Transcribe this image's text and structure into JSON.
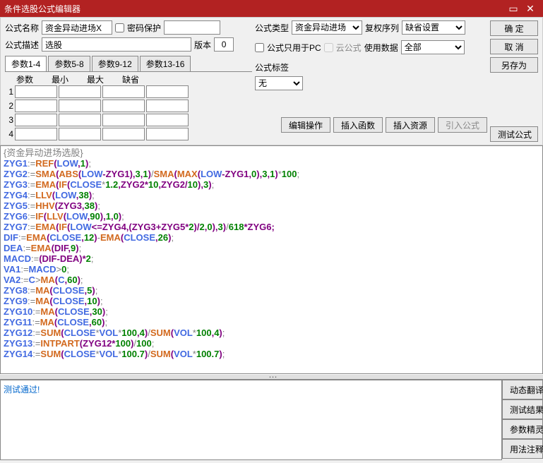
{
  "title": "条件选股公式编辑器",
  "labels": {
    "name": "公式名称",
    "pwprotect": "密码保护",
    "type": "公式类型",
    "rightseq": "复权序列",
    "desc": "公式描述",
    "version": "版本",
    "pconly": "公式只用于PC",
    "cloud": "云公式",
    "usedata": "使用数据",
    "tag": "公式标签"
  },
  "fields": {
    "name": "资金异动进场X",
    "desc": "选股",
    "version": "0",
    "type": "资金异动进场",
    "rightseq": "缺省设置",
    "usedata": "全部",
    "tag": "无"
  },
  "buttons": {
    "ok": "确 定",
    "cancel": "取 消",
    "saveas": "另存为",
    "editop": "编辑操作",
    "insfn": "插入函数",
    "insres": "插入资源",
    "imp": "引入公式",
    "test": "测试公式",
    "dyntr": "动态翻译",
    "testres": "测试结果",
    "paramwiz": "参数精灵",
    "usage": "用法注释"
  },
  "tabs": [
    "参数1-4",
    "参数5-8",
    "参数9-12",
    "参数13-16"
  ],
  "paramheaders": [
    "参数",
    "最小",
    "最大",
    "缺省"
  ],
  "codehead": "{资金异动进场选股}",
  "message": "测试通过!",
  "code": [
    [
      [
        "ZYG1",
        "kw"
      ],
      [
        ":=",
        "op"
      ],
      [
        "REF",
        "fn"
      ],
      [
        "(",
        "pn"
      ],
      [
        "LOW",
        "kw"
      ],
      [
        ",",
        "pn"
      ],
      [
        "1",
        "nm"
      ],
      [
        ")",
        "pn"
      ],
      [
        ";",
        "op"
      ]
    ],
    [
      [
        "ZYG2",
        "kw"
      ],
      [
        ":=",
        "op"
      ],
      [
        "SMA",
        "fn"
      ],
      [
        "(",
        "pn"
      ],
      [
        "ABS",
        "fn"
      ],
      [
        "(",
        "pn"
      ],
      [
        "LOW",
        "kw"
      ],
      [
        "-ZYG1)",
        "pn"
      ],
      [
        ",",
        "pn"
      ],
      [
        "3",
        "nm"
      ],
      [
        ",",
        "pn"
      ],
      [
        "1",
        "nm"
      ],
      [
        ")",
        "pn"
      ],
      [
        "/",
        "op"
      ],
      [
        "SMA",
        "fn"
      ],
      [
        "(",
        "pn"
      ],
      [
        "MAX",
        "fn"
      ],
      [
        "(",
        "pn"
      ],
      [
        "LOW",
        "kw"
      ],
      [
        "-ZYG1",
        "pn"
      ],
      [
        ",",
        "pn"
      ],
      [
        "0",
        "nm"
      ],
      [
        ")",
        "pn"
      ],
      [
        ",",
        "pn"
      ],
      [
        "3",
        "nm"
      ],
      [
        ",",
        "pn"
      ],
      [
        "1",
        "nm"
      ],
      [
        ")",
        "pn"
      ],
      [
        "*",
        "op"
      ],
      [
        "100",
        "nm"
      ],
      [
        ";",
        "op"
      ]
    ],
    [
      [
        "ZYG3",
        "kw"
      ],
      [
        ":=",
        "op"
      ],
      [
        "EMA",
        "fn"
      ],
      [
        "(",
        "pn"
      ],
      [
        "IF",
        "fn"
      ],
      [
        "(",
        "pn"
      ],
      [
        "CLOSE",
        "kw"
      ],
      [
        "*",
        "op"
      ],
      [
        "1.2",
        "nm"
      ],
      [
        ",ZYG2*",
        "pn"
      ],
      [
        "10",
        "nm"
      ],
      [
        ",ZYG2/",
        "pn"
      ],
      [
        "10",
        "nm"
      ],
      [
        ")",
        "pn"
      ],
      [
        ",",
        "pn"
      ],
      [
        "3",
        "nm"
      ],
      [
        ")",
        "pn"
      ],
      [
        ";",
        "op"
      ]
    ],
    [
      [
        "ZYG4",
        "kw"
      ],
      [
        ":=",
        "op"
      ],
      [
        "LLV",
        "fn"
      ],
      [
        "(",
        "pn"
      ],
      [
        "LOW",
        "kw"
      ],
      [
        ",",
        "pn"
      ],
      [
        "38",
        "nm"
      ],
      [
        ")",
        "pn"
      ],
      [
        ";",
        "op"
      ]
    ],
    [
      [
        "ZYG5",
        "kw"
      ],
      [
        ":=",
        "op"
      ],
      [
        "HHV",
        "fn"
      ],
      [
        "(ZYG3,",
        "pn"
      ],
      [
        "38",
        "nm"
      ],
      [
        ")",
        "pn"
      ],
      [
        ";",
        "op"
      ]
    ],
    [
      [
        "ZYG6",
        "kw"
      ],
      [
        ":=",
        "op"
      ],
      [
        "IF",
        "fn"
      ],
      [
        "(",
        "pn"
      ],
      [
        "LLV",
        "fn"
      ],
      [
        "(",
        "pn"
      ],
      [
        "LOW",
        "kw"
      ],
      [
        ",",
        "pn"
      ],
      [
        "90",
        "nm"
      ],
      [
        ")",
        "pn"
      ],
      [
        ",",
        "pn"
      ],
      [
        "1",
        "nm"
      ],
      [
        ",",
        "pn"
      ],
      [
        "0",
        "nm"
      ],
      [
        ")",
        "pn"
      ],
      [
        ";",
        "op"
      ]
    ],
    [
      [
        "ZYG7",
        "kw"
      ],
      [
        ":=",
        "op"
      ],
      [
        "EMA",
        "fn"
      ],
      [
        "(",
        "pn"
      ],
      [
        "IF",
        "fn"
      ],
      [
        "(",
        "pn"
      ],
      [
        "LOW",
        "kw"
      ],
      [
        "<=ZYG4,(ZYG3+ZYG5*",
        "pn"
      ],
      [
        "2",
        "nm"
      ],
      [
        ")/",
        "pn"
      ],
      [
        "2",
        "nm"
      ],
      [
        ",",
        "pn"
      ],
      [
        "0",
        "nm"
      ],
      [
        ")",
        "pn"
      ],
      [
        ",",
        "pn"
      ],
      [
        "3",
        "nm"
      ],
      [
        ")",
        "pn"
      ],
      [
        "/",
        "op"
      ],
      [
        "618",
        "nm"
      ],
      [
        "*ZYG6;",
        "pn"
      ]
    ],
    [
      [
        "DIF",
        "kw"
      ],
      [
        ":=",
        "op"
      ],
      [
        "EMA",
        "fn"
      ],
      [
        "(",
        "pn"
      ],
      [
        "CLOSE",
        "kw"
      ],
      [
        ",",
        "pn"
      ],
      [
        "12",
        "nm"
      ],
      [
        ")",
        "pn"
      ],
      [
        "-",
        "op"
      ],
      [
        "EMA",
        "fn"
      ],
      [
        "(",
        "pn"
      ],
      [
        "CLOSE",
        "kw"
      ],
      [
        ",",
        "pn"
      ],
      [
        "26",
        "nm"
      ],
      [
        ")",
        "pn"
      ],
      [
        ";",
        "op"
      ]
    ],
    [
      [
        "DEA",
        "kw"
      ],
      [
        ":=",
        "op"
      ],
      [
        "EMA",
        "fn"
      ],
      [
        "(DIF,",
        "pn"
      ],
      [
        "9",
        "nm"
      ],
      [
        ")",
        "pn"
      ],
      [
        ";",
        "op"
      ]
    ],
    [
      [
        "MACD",
        "kw"
      ],
      [
        ":=",
        "op"
      ],
      [
        "(DIF-DEA)*",
        "pn"
      ],
      [
        "2",
        "nm"
      ],
      [
        ";",
        "op"
      ]
    ],
    [
      [
        "VA1",
        "kw"
      ],
      [
        ":=",
        "op"
      ],
      [
        "MACD",
        "kw"
      ],
      [
        ">",
        "op"
      ],
      [
        "0",
        "nm"
      ],
      [
        ";",
        "op"
      ]
    ],
    [
      [
        "VA2",
        "kw"
      ],
      [
        ":=",
        "op"
      ],
      [
        "C",
        "kw"
      ],
      [
        ">",
        "op"
      ],
      [
        "MA",
        "fn"
      ],
      [
        "(",
        "pn"
      ],
      [
        "C",
        "kw"
      ],
      [
        ",",
        "pn"
      ],
      [
        "60",
        "nm"
      ],
      [
        ")",
        "pn"
      ],
      [
        ";",
        "op"
      ]
    ],
    [
      [
        "ZYG8",
        "kw"
      ],
      [
        ":=",
        "op"
      ],
      [
        "MA",
        "fn"
      ],
      [
        "(",
        "pn"
      ],
      [
        "CLOSE",
        "kw"
      ],
      [
        ",",
        "pn"
      ],
      [
        "5",
        "nm"
      ],
      [
        ")",
        "pn"
      ],
      [
        ";",
        "op"
      ]
    ],
    [
      [
        "ZYG9",
        "kw"
      ],
      [
        ":=",
        "op"
      ],
      [
        "MA",
        "fn"
      ],
      [
        "(",
        "pn"
      ],
      [
        "CLOSE",
        "kw"
      ],
      [
        ",",
        "pn"
      ],
      [
        "10",
        "nm"
      ],
      [
        ")",
        "pn"
      ],
      [
        ";",
        "op"
      ]
    ],
    [
      [
        "ZYG10",
        "kw"
      ],
      [
        ":=",
        "op"
      ],
      [
        "MA",
        "fn"
      ],
      [
        "(",
        "pn"
      ],
      [
        "CLOSE",
        "kw"
      ],
      [
        ",",
        "pn"
      ],
      [
        "30",
        "nm"
      ],
      [
        ")",
        "pn"
      ],
      [
        ";",
        "op"
      ]
    ],
    [
      [
        "ZYG11",
        "kw"
      ],
      [
        ":=",
        "op"
      ],
      [
        "MA",
        "fn"
      ],
      [
        "(",
        "pn"
      ],
      [
        "CLOSE",
        "kw"
      ],
      [
        ",",
        "pn"
      ],
      [
        "60",
        "nm"
      ],
      [
        ")",
        "pn"
      ],
      [
        ";",
        "op"
      ]
    ],
    [
      [
        "ZYG12",
        "kw"
      ],
      [
        ":=",
        "op"
      ],
      [
        "SUM",
        "fn"
      ],
      [
        "(",
        "pn"
      ],
      [
        "CLOSE",
        "kw"
      ],
      [
        "*",
        "op"
      ],
      [
        "VOL",
        "kw"
      ],
      [
        "*",
        "op"
      ],
      [
        "100",
        "nm"
      ],
      [
        ",",
        "pn"
      ],
      [
        "4",
        "nm"
      ],
      [
        ")",
        "pn"
      ],
      [
        "/",
        "op"
      ],
      [
        "SUM",
        "fn"
      ],
      [
        "(",
        "pn"
      ],
      [
        "VOL",
        "kw"
      ],
      [
        "*",
        "op"
      ],
      [
        "100",
        "nm"
      ],
      [
        ",",
        "pn"
      ],
      [
        "4",
        "nm"
      ],
      [
        ")",
        "pn"
      ],
      [
        ";",
        "op"
      ]
    ],
    [
      [
        "ZYG13",
        "kw"
      ],
      [
        ":=",
        "op"
      ],
      [
        "INTPART",
        "fn"
      ],
      [
        "(ZYG12*",
        "pn"
      ],
      [
        "100",
        "nm"
      ],
      [
        ")",
        "pn"
      ],
      [
        "/",
        "op"
      ],
      [
        "100",
        "nm"
      ],
      [
        ";",
        "op"
      ]
    ],
    [
      [
        "ZYG14",
        "kw"
      ],
      [
        ":=",
        "op"
      ],
      [
        "SUM",
        "fn"
      ],
      [
        "(",
        "pn"
      ],
      [
        "CLOSE",
        "kw"
      ],
      [
        "*",
        "op"
      ],
      [
        "VOL",
        "kw"
      ],
      [
        "*",
        "op"
      ],
      [
        "100.7",
        "nm"
      ],
      [
        ")",
        "pn"
      ],
      [
        "/",
        "op"
      ],
      [
        "SUM",
        "fn"
      ],
      [
        "(",
        "pn"
      ],
      [
        "VOL",
        "kw"
      ],
      [
        "*",
        "op"
      ],
      [
        "100.7",
        "nm"
      ],
      [
        ")",
        "pn"
      ],
      [
        ";",
        "op"
      ]
    ]
  ]
}
